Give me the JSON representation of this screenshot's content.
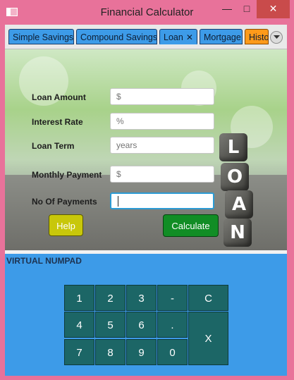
{
  "window": {
    "title": "Financial Calculator",
    "minimize": "—",
    "maximize": "□",
    "close": "✕"
  },
  "tabs": [
    {
      "label": "Simple Savings"
    },
    {
      "label": "Compound Savings"
    },
    {
      "label": "Loan",
      "close": "✕"
    },
    {
      "label": "Mortgage"
    },
    {
      "label": "Histo"
    }
  ],
  "form": {
    "loan_amount": {
      "label": "Loan Amount",
      "placeholder": "$"
    },
    "interest_rate": {
      "label": "Interest Rate",
      "placeholder": "%"
    },
    "loan_term": {
      "label": "Loan Term",
      "placeholder": "years"
    },
    "monthly_payment": {
      "label": "Monthly Payment",
      "placeholder": "$"
    },
    "no_of_payments": {
      "label": "No Of Payments",
      "value": ""
    }
  },
  "image_letters": [
    "L",
    "O",
    "A",
    "N"
  ],
  "buttons": {
    "help": "Help",
    "calculate": "Calculate"
  },
  "numpad": {
    "title": "VIRTUAL NUMPAD",
    "keys": {
      "k1": "1",
      "k2": "2",
      "k3": "3",
      "minus": "-",
      "clear": "C",
      "k4": "4",
      "k5": "5",
      "k6": "6",
      "dot": ".",
      "k7": "7",
      "k8": "8",
      "k9": "9",
      "k0": "0",
      "backspace": "X"
    }
  },
  "colors": {
    "title_bar": "#e8729a",
    "tab": "#3d9be8",
    "tab_history": "#ff9a1a",
    "help_button": "#c8c70a",
    "calculate_button": "#118d25",
    "numpad_background": "#3d9be8",
    "numpad_key": "#1c6666"
  }
}
